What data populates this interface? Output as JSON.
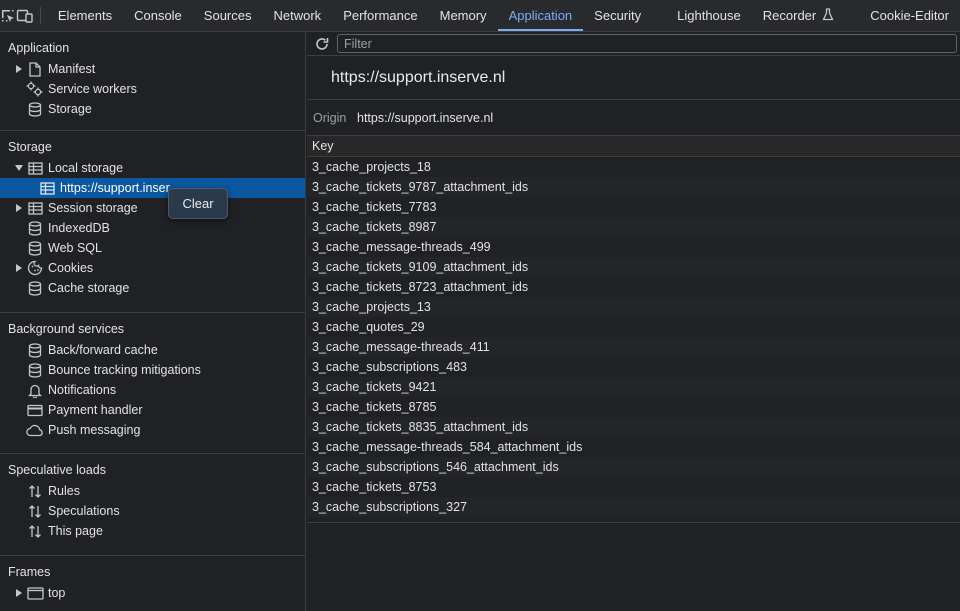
{
  "toolbar": {
    "tabs": [
      {
        "label": "Elements"
      },
      {
        "label": "Console"
      },
      {
        "label": "Sources"
      },
      {
        "label": "Network"
      },
      {
        "label": "Performance"
      },
      {
        "label": "Memory"
      },
      {
        "label": "Application"
      },
      {
        "label": "Security"
      },
      {
        "label": "Lighthouse"
      },
      {
        "label": "Recorder"
      },
      {
        "label": "Cookie-Editor"
      }
    ],
    "active_tab": "Application"
  },
  "sidebar": {
    "application": {
      "title": "Application",
      "items": [
        {
          "label": "Manifest",
          "icon": "document-icon"
        },
        {
          "label": "Service workers",
          "icon": "gears-icon"
        },
        {
          "label": "Storage",
          "icon": "database-icon"
        }
      ]
    },
    "storage": {
      "title": "Storage",
      "items": [
        {
          "label": "Local storage",
          "icon": "table-icon"
        },
        {
          "label": "https://support.inser",
          "icon": "table-icon"
        },
        {
          "label": "Session storage",
          "icon": "table-icon"
        },
        {
          "label": "IndexedDB",
          "icon": "database-icon"
        },
        {
          "label": "Web SQL",
          "icon": "database-icon"
        },
        {
          "label": "Cookies",
          "icon": "cookie-icon"
        },
        {
          "label": "Cache storage",
          "icon": "database-icon"
        }
      ]
    },
    "background": {
      "title": "Background services",
      "items": [
        {
          "label": "Back/forward cache",
          "icon": "database-icon"
        },
        {
          "label": "Bounce tracking mitigations",
          "icon": "database-icon"
        },
        {
          "label": "Notifications",
          "icon": "bell-icon"
        },
        {
          "label": "Payment handler",
          "icon": "card-icon"
        },
        {
          "label": "Push messaging",
          "icon": "cloud-icon"
        }
      ]
    },
    "speculative": {
      "title": "Speculative loads",
      "items": [
        {
          "label": "Rules",
          "icon": "arrows-icon"
        },
        {
          "label": "Speculations",
          "icon": "arrows-icon"
        },
        {
          "label": "This page",
          "icon": "arrows-icon"
        }
      ]
    },
    "frames": {
      "title": "Frames",
      "items": [
        {
          "label": "top",
          "icon": "frame-icon"
        }
      ]
    }
  },
  "tooltip": {
    "label": "Clear"
  },
  "main": {
    "filter_placeholder": "Filter",
    "origin_title": "https://support.inserve.nl",
    "origin_label": "Origin",
    "origin_value": "https://support.inserve.nl",
    "table": {
      "header": "Key",
      "rows": [
        "3_cache_projects_18",
        "3_cache_tickets_9787_attachment_ids",
        "3_cache_tickets_7783",
        "3_cache_tickets_8987",
        "3_cache_message-threads_499",
        "3_cache_tickets_9109_attachment_ids",
        "3_cache_tickets_8723_attachment_ids",
        "3_cache_projects_13",
        "3_cache_quotes_29",
        "3_cache_message-threads_411",
        "3_cache_subscriptions_483",
        "3_cache_tickets_9421",
        "3_cache_tickets_8785",
        "3_cache_tickets_8835_attachment_ids",
        "3_cache_message-threads_584_attachment_ids",
        "3_cache_subscriptions_546_attachment_ids",
        "3_cache_tickets_8753",
        "3_cache_subscriptions_327"
      ]
    }
  },
  "colors": {
    "accent": "#7cacf8",
    "selected_bg": "#0b57a0",
    "background": "#202124"
  }
}
